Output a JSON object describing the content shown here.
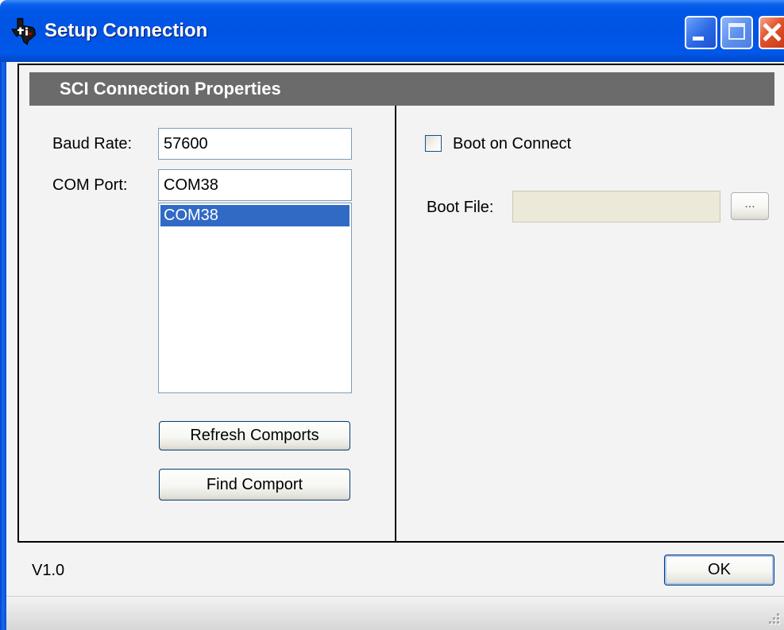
{
  "window": {
    "title": "Setup Connection",
    "app_icon": "ti-logo-icon",
    "controls": [
      "minimize-icon",
      "maximize-icon",
      "close-icon"
    ]
  },
  "panel": {
    "header": "SCI Connection Properties",
    "left": {
      "baud_rate": {
        "label": "Baud Rate:",
        "value": "57600"
      },
      "com_port": {
        "label": "COM Port:",
        "value": "COM38",
        "options": [
          "COM38"
        ],
        "selected_index": 0
      },
      "refresh_button": "Refresh Comports",
      "find_button": "Find Comport"
    },
    "right": {
      "boot_on_connect": {
        "label": "Boot on Connect",
        "checked": false
      },
      "boot_file": {
        "label": "Boot File:",
        "value": "",
        "enabled": false,
        "browse_label": "..."
      }
    }
  },
  "footer": {
    "version": "V1.0",
    "ok_button": "OK"
  },
  "colors": {
    "header_bar": "#6B6B6B",
    "selection": "#316AC5",
    "disabled_field": "#ECE9D8"
  }
}
